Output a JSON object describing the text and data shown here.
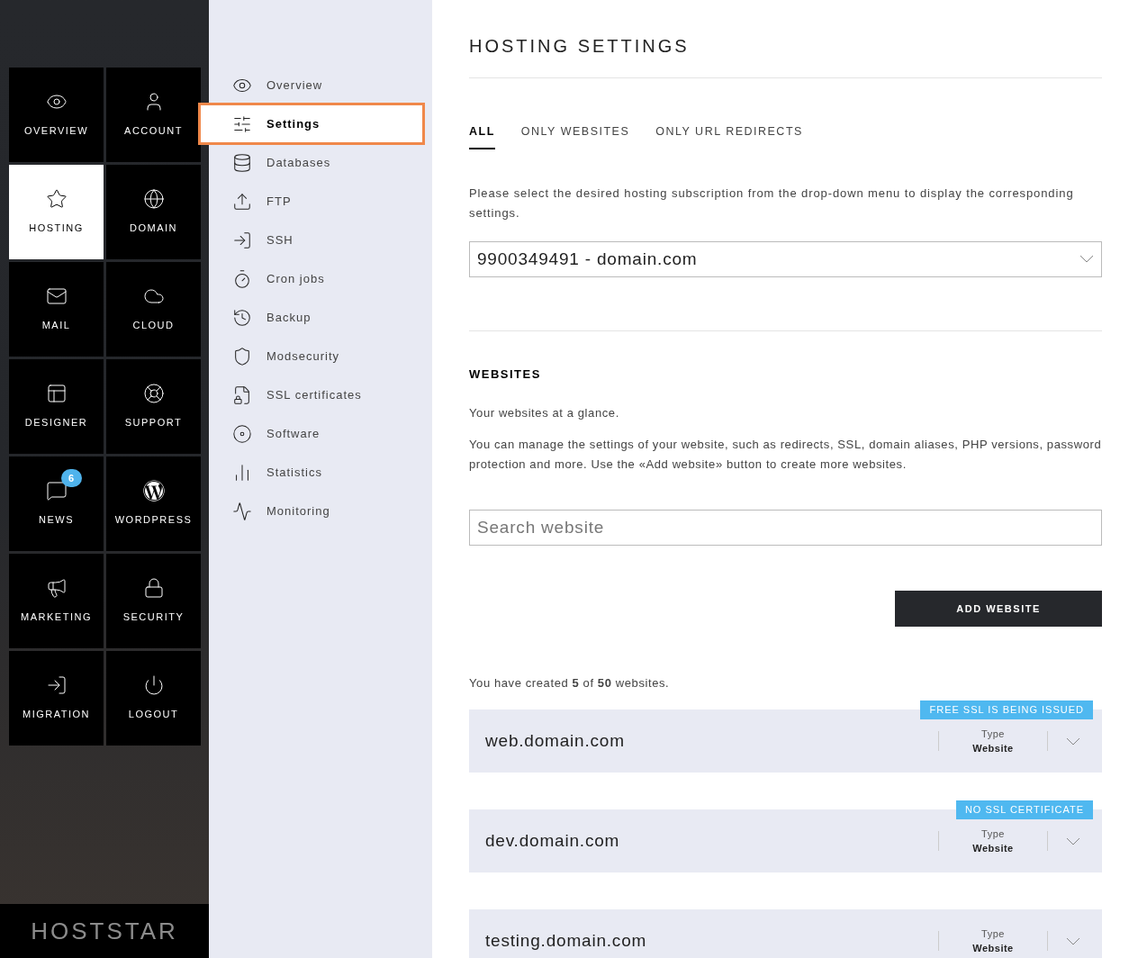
{
  "main_nav": [
    {
      "label": "OVERVIEW",
      "selected": false
    },
    {
      "label": "ACCOUNT",
      "selected": false
    },
    {
      "label": "HOSTING",
      "selected": true
    },
    {
      "label": "DOMAIN",
      "selected": false
    },
    {
      "label": "MAIL",
      "selected": false
    },
    {
      "label": "CLOUD",
      "selected": false
    },
    {
      "label": "DESIGNER",
      "selected": false
    },
    {
      "label": "SUPPORT",
      "selected": false
    },
    {
      "label": "NEWS",
      "selected": false,
      "badge": "6"
    },
    {
      "label": "WORDPRESS",
      "selected": false
    },
    {
      "label": "MARKETING",
      "selected": false
    },
    {
      "label": "SECURITY",
      "selected": false
    },
    {
      "label": "MIGRATION",
      "selected": false
    },
    {
      "label": "LOGOUT",
      "selected": false
    }
  ],
  "logo": "HOSTSTAR",
  "sub_nav": [
    {
      "label": "Overview",
      "selected": false
    },
    {
      "label": "Settings",
      "selected": true
    },
    {
      "label": "Databases",
      "selected": false
    },
    {
      "label": "FTP",
      "selected": false
    },
    {
      "label": "SSH",
      "selected": false
    },
    {
      "label": "Cron jobs",
      "selected": false
    },
    {
      "label": "Backup",
      "selected": false
    },
    {
      "label": "Modsecurity",
      "selected": false
    },
    {
      "label": "SSL certificates",
      "selected": false
    },
    {
      "label": "Software",
      "selected": false
    },
    {
      "label": "Statistics",
      "selected": false
    },
    {
      "label": "Monitoring",
      "selected": false
    }
  ],
  "title": "HOSTING SETTINGS",
  "tabs": [
    {
      "label": "ALL",
      "selected": true
    },
    {
      "label": "ONLY WEBSITES",
      "selected": false
    },
    {
      "label": "ONLY URL REDIRECTS",
      "selected": false
    }
  ],
  "intro": "Please select the desired hosting subscription from the drop-down menu to display the corresponding settings.",
  "subscription_select": {
    "value": "9900349491 - domain.com"
  },
  "websites": {
    "heading": "WEBSITES",
    "lead": "Your websites at a glance.",
    "description": "You can manage the settings of your website, such as redirects, SSL, domain aliases, PHP versions, password protection and more. Use the «Add website» button to create more websites.",
    "search": {
      "placeholder": "Search website"
    },
    "add_button": "ADD WEBSITE",
    "count_text": "You have created **5** of **50** websites.",
    "items": [
      {
        "name": "web.domain.com",
        "type_label": "Type",
        "type": "Website",
        "tag": "FREE SSL IS BEING ISSUED"
      },
      {
        "name": "dev.domain.com",
        "type_label": "Type",
        "type": "Website",
        "tag": "NO SSL CERTIFICATE"
      },
      {
        "name": "testing.domain.com",
        "type_label": "Type",
        "type": "Website"
      }
    ]
  }
}
